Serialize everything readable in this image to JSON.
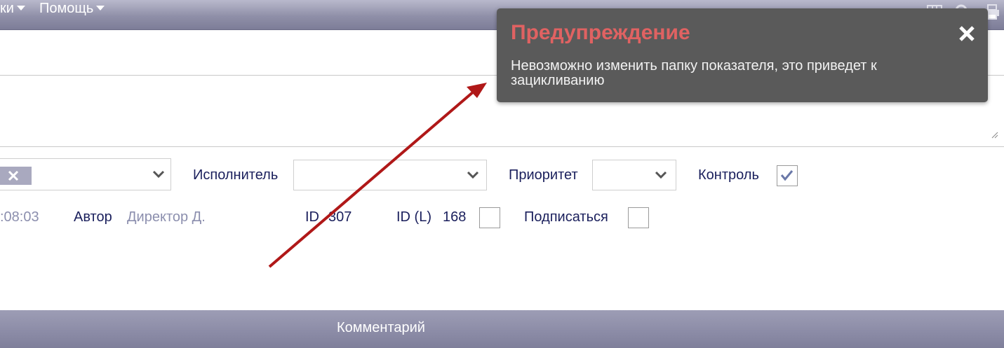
{
  "top_menu": {
    "items": [
      {
        "label": "ки"
      },
      {
        "label": "Помощь"
      }
    ]
  },
  "form": {
    "assignee_label": "Исполнитель",
    "priority_label": "Приоритет",
    "control_label": "Контроль",
    "control_checked": true,
    "time_partial": ":08:03",
    "author_label": "Автор",
    "author_value": "Директор Д.",
    "id_label": "ID",
    "id_value": "307",
    "idl_label": "ID (L)",
    "idl_value": "168",
    "subscribe_label": "Подписаться"
  },
  "bottom": {
    "title": "Комментарий"
  },
  "toast": {
    "title": "Предупреждение",
    "message": "Невозможно изменить папку показателя, это приведет к зацикливанию"
  },
  "colors": {
    "toast_title": "#e06262",
    "toast_bg": "#5a5a5a",
    "arrow": "#b01818",
    "label": "#1a1f5c"
  }
}
